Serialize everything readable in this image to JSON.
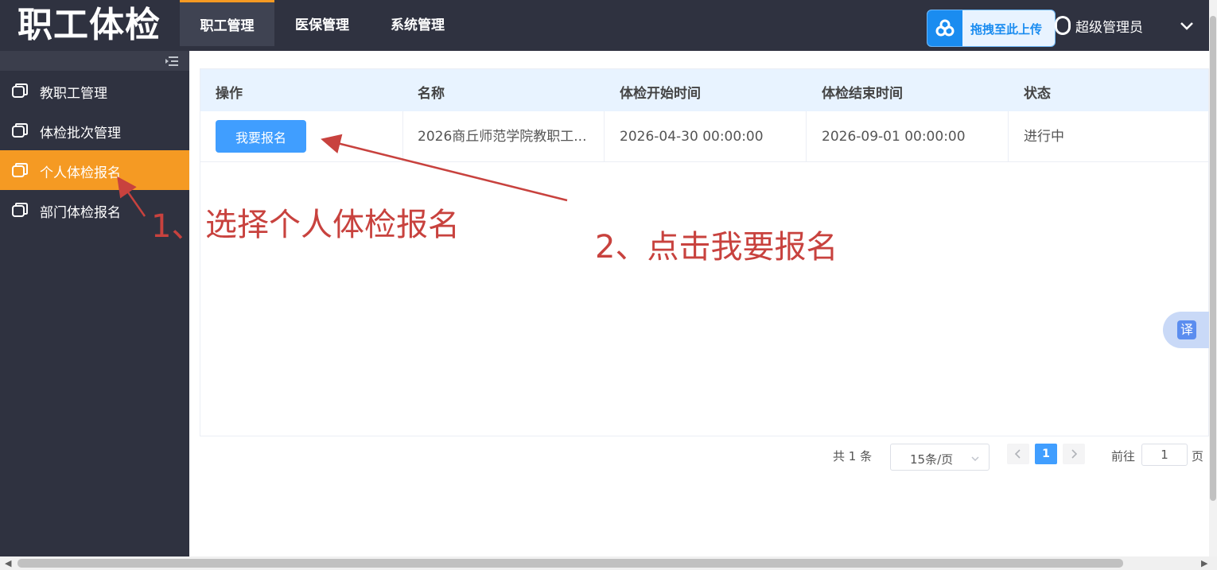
{
  "app": {
    "title": "职工体检"
  },
  "nav": {
    "tabs": [
      {
        "label": "职工管理",
        "active": true
      },
      {
        "label": "医保管理",
        "active": false
      },
      {
        "label": "系统管理",
        "active": false
      }
    ]
  },
  "upload_widget": {
    "label": "拖拽至此上传",
    "icon": "cloud-upload-icon"
  },
  "user": {
    "name": "超级管理员",
    "icon": "user-icon"
  },
  "sidebar": {
    "items": [
      {
        "label": "教职工管理",
        "active": false
      },
      {
        "label": "体检批次管理",
        "active": false
      },
      {
        "label": "个人体检报名",
        "active": true
      },
      {
        "label": "部门体检报名",
        "active": false
      }
    ]
  },
  "table": {
    "columns": [
      "操作",
      "名称",
      "体检开始时间",
      "体检结束时间",
      "状态"
    ],
    "rows": [
      {
        "action": "我要报名",
        "name": "2026商丘师范学院教职工...",
        "start": "2026-04-30 00:00:00",
        "end": "2026-09-01 00:00:00",
        "status": "进行中"
      }
    ]
  },
  "pagination": {
    "total_text": "共 1 条",
    "page_size": "15条/页",
    "current_page": "1",
    "goto_label": "前往",
    "goto_value": "1",
    "goto_suffix": "页"
  },
  "annotations": {
    "step1": "1、",
    "step1_text": "选择个人体检报名",
    "step2": "2、点击我要报名",
    "color": "#c8423e"
  },
  "translate_float": {
    "label": "译"
  },
  "colors": {
    "accent": "#f59a23",
    "primary": "#409eff",
    "dark": "#2f3240"
  }
}
